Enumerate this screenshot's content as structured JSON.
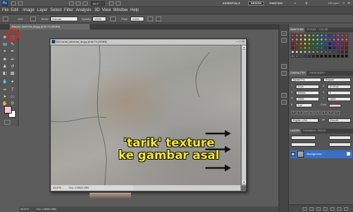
{
  "app": {
    "logo": "Ps",
    "zoom": "66.7",
    "workspaces": [
      "ESSENTIALS",
      "DESIGN",
      "PAINTING"
    ],
    "active_workspace": "DESIGN",
    "cs_live": "CS Live",
    "window_controls": [
      "–",
      "□",
      "✕"
    ]
  },
  "menu": [
    "File",
    "Edit",
    "Image",
    "Layer",
    "Select",
    "Filter",
    "Analysis",
    "3D",
    "View",
    "Window",
    "Help"
  ],
  "options": {
    "brush_size": "200",
    "mode_label": "Mode:",
    "mode_value": "Normal",
    "opacity_label": "Opacity:",
    "opacity_value": "100%",
    "flow_label": "Flow:",
    "flow_value": "100%"
  },
  "doc_tab": "Bliss-ibc.Jan09.Ris_bb.jpg @ 66.7% (RGB/8)",
  "docwin": {
    "title": "DSC.txt.bel_bk.txt.bel_bk.jpg @ 66.7% (RGB/8)",
    "buttons": "– □ ✕",
    "status_zoom": "66.67%",
    "status_doc": "Doc: 2.25M/2.25M"
  },
  "app_status": {
    "zoom": "66.67%",
    "doc": "Doc: 1.86M/1.86M"
  },
  "annotation": {
    "line1": "'tarik' texture",
    "line2": "ke gambar asal"
  },
  "panels": {
    "swatch_tabs": [
      "SWATCHES",
      "STYLES",
      "COLOR"
    ],
    "character_tabs": [
      "CHARACTER",
      "PARAGRAPH"
    ],
    "font_family": "Myriad Pro",
    "font_style": "Regular",
    "font_size": "24 pt",
    "leading": "37.33 pt",
    "kerning": "Metrics",
    "tracking": "0",
    "vscale": "100%",
    "hscale": "100%",
    "baseline": "0 pt",
    "color_label": "Color:",
    "language": "English: USA",
    "antialias": "Smooth",
    "layer_tabs": [
      "LAYERS",
      "CHANNELS",
      "PATHS"
    ],
    "layer_name": "Background"
  },
  "colors": {
    "foreground": "#f2c4d4",
    "background": "#ffffff",
    "annotation_text": "#f6ea2a",
    "highlight_circle": "#e0201c",
    "layer_selected": "#3a6fc4"
  },
  "icons": [
    "move-tool-icon",
    "marquee-tool-icon",
    "lasso-tool-icon",
    "quick-select-tool-icon",
    "crop-tool-icon",
    "eyedropper-tool-icon",
    "healing-brush-icon",
    "brush-tool-icon",
    "clone-stamp-icon",
    "history-brush-icon",
    "eraser-icon",
    "gradient-tool-icon",
    "blur-tool-icon",
    "dodge-tool-icon",
    "pen-tool-icon",
    "type-tool-icon",
    "path-select-icon",
    "shape-tool-icon",
    "hand-tool-icon",
    "zoom-tool-icon"
  ]
}
